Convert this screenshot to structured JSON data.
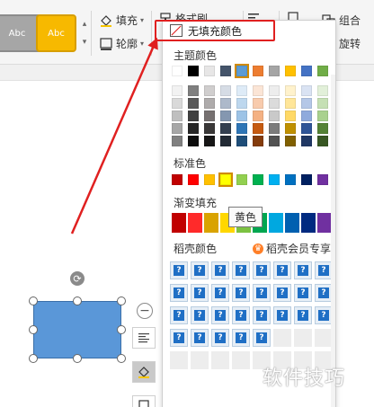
{
  "ribbon": {
    "style_gray_label": "Abc",
    "style_yellow_label": "Abc",
    "fill_label": "填充",
    "outline_label": "轮廓",
    "format_painter_label": "格式刷",
    "group_label": "组合",
    "rotate_label": "旋转"
  },
  "dropdown": {
    "no_fill_label": "无填充颜色",
    "theme_colors_label": "主题颜色",
    "standard_colors_label": "标准色",
    "gradient_fill_label": "渐变填充",
    "docer_colors_label": "稻壳颜色",
    "docer_vip_label": "稻壳会员专享",
    "premium_tile_glyph": "?"
  },
  "theme_colors": {
    "top_row": [
      "#ffffff",
      "#000000",
      "#e7e6e6",
      "#44546a",
      "#5b9bd5",
      "#ed7d31",
      "#a5a5a5",
      "#ffc000",
      "#4472c4",
      "#70ad47"
    ],
    "selected_index": 4,
    "shades": [
      [
        "#f2f2f2",
        "#d9d9d9",
        "#bfbfbf",
        "#a6a6a6",
        "#808080"
      ],
      [
        "#7f7f7f",
        "#595959",
        "#404040",
        "#262626",
        "#0d0d0d"
      ],
      [
        "#d0cece",
        "#aeabab",
        "#767171",
        "#3a3838",
        "#171616"
      ],
      [
        "#d6dce5",
        "#adb9ca",
        "#8497b0",
        "#333f50",
        "#222a35"
      ],
      [
        "#deebf7",
        "#bdd7ee",
        "#9dc3e6",
        "#2e75b6",
        "#1f4e79"
      ],
      [
        "#fbe5d6",
        "#f8cbad",
        "#f4b183",
        "#c55a11",
        "#843c0c"
      ],
      [
        "#ededed",
        "#dbdbdb",
        "#c9c9c9",
        "#7b7b7b",
        "#525252"
      ],
      [
        "#fff2cc",
        "#ffe699",
        "#ffd966",
        "#bf9000",
        "#806000"
      ],
      [
        "#dae3f3",
        "#b4c7e7",
        "#8faadc",
        "#2f5597",
        "#203864"
      ],
      [
        "#e2f0d9",
        "#c5e0b4",
        "#a9d18e",
        "#548235",
        "#385723"
      ]
    ]
  },
  "standard_colors": {
    "colors": [
      "#c00000",
      "#ff0000",
      "#ffc000",
      "#ffff00",
      "#92d050",
      "#00b050",
      "#00b0f0",
      "#0070c0",
      "#002060",
      "#7030a0"
    ],
    "selected_index": 3
  },
  "gradient_colors": {
    "colors": [
      "#c00000",
      "#ff2a2a",
      "#d9a300",
      "#ffd700",
      "#7cc242",
      "#00a650",
      "#00a8e0",
      "#0060b0",
      "#002a80",
      "#7030a0"
    ],
    "selected_index": 3
  },
  "docer_grid": {
    "premium_count": 29,
    "total": 40,
    "columns": 8
  },
  "tooltip": {
    "text": "黄色"
  },
  "watermark": {
    "text": "软件技巧"
  },
  "colors": {
    "highlight": "#e02020",
    "arrow": "#e02020",
    "shape_fill": "#5a97d8",
    "accent": "#1f6fc5"
  }
}
